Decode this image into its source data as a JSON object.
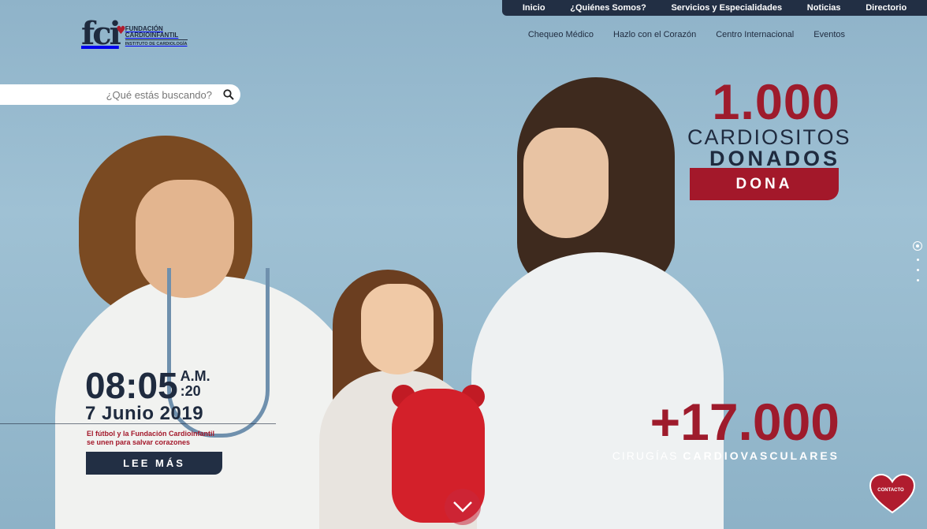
{
  "brand": {
    "logo_mark": "fci",
    "line1": "FUNDACIÓN",
    "line2": "CARDIOINFANTIL",
    "line3": "INSTITUTO DE CARDIOLOGÍA",
    "primary_color": "#9e1b2c",
    "navy_color": "#222f44"
  },
  "topnav": {
    "items": [
      "Inicio",
      "¿Quiénes Somos?",
      "Servicios y Especialidades",
      "Noticias",
      "Directorio"
    ]
  },
  "subnav": {
    "items": [
      "Chequeo Médico",
      "Hazlo con el Corazón",
      "Centro Internacional",
      "Eventos"
    ]
  },
  "search": {
    "placeholder": "¿Qué estás buscando?",
    "icon": "search-icon"
  },
  "stat1": {
    "number": "1.000",
    "line1": "CARDIOSITOS",
    "line2": "DONADOS",
    "button": "DONA"
  },
  "stat2": {
    "number": "+17.000",
    "label_regular": "CIRUGÍAS",
    "label_bold": "CARDIOVASCULARES"
  },
  "clock": {
    "time": "08:05",
    "ampm": "A.M.",
    "seconds": ":20",
    "date": "7 Junio 2019"
  },
  "news": {
    "line1": "El fútbol y la Fundación Cardioinfantil",
    "line2": "se unen para salvar corazones",
    "button": "LEE MÁS"
  },
  "slider": {
    "total": 4,
    "active_index": 0
  },
  "contact": {
    "label": "CONTACTO",
    "icon": "heart-icon"
  },
  "scroll_icon": "chevron-down-icon"
}
